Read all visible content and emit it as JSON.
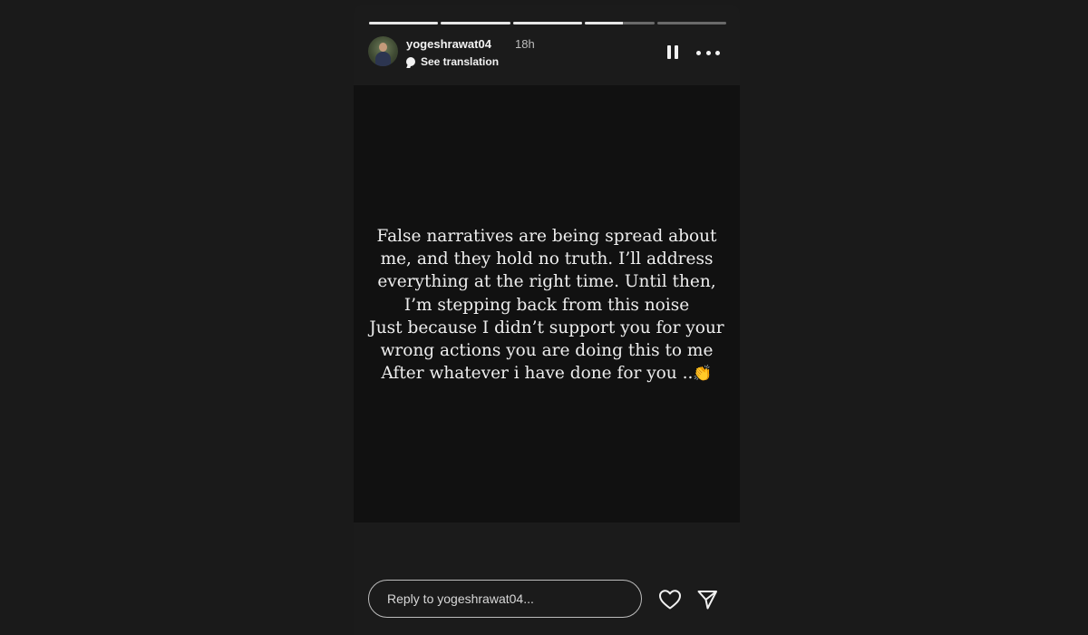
{
  "story": {
    "progress": [
      1,
      1,
      1,
      0.55,
      0
    ],
    "user": {
      "username": "yogeshrawat04",
      "time_ago": "18h",
      "translation_label": "See translation",
      "avatar_icon": "user-avatar"
    },
    "controls": {
      "pause_icon": "pause-icon",
      "more_icon": "more-options-icon"
    },
    "caption_lines": [
      "False narratives are being spread about",
      "me, and they hold no truth. I’ll address",
      "everything at the right time. Until then,",
      "I’m stepping back from this noise",
      "Just because I didn’t support you for your",
      "wrong actions you are doing this to me",
      "After whatever i have done for you .."
    ],
    "caption_emoji": "👏",
    "reply_placeholder": "Reply to yogeshrawat04...",
    "actions": {
      "like_icon": "heart-icon",
      "share_icon": "send-icon"
    }
  },
  "colors": {
    "background": "#1a1a1a",
    "story_background": "#111111",
    "text": "#eeeeee"
  }
}
